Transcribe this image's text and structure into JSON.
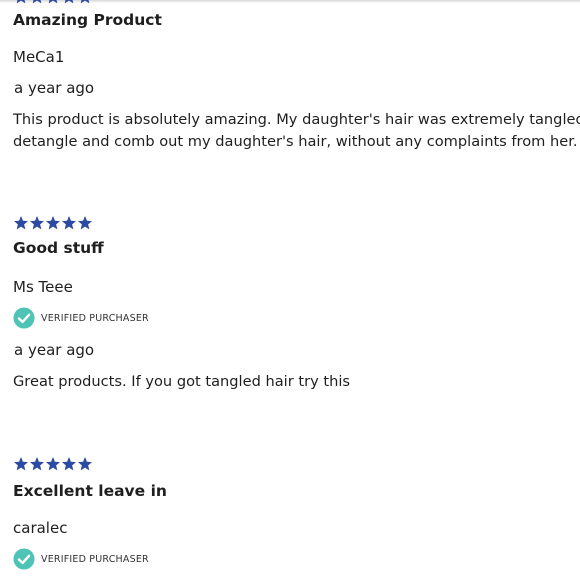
{
  "colors": {
    "star": "#2b4aa0",
    "verified": "#4fc3b5",
    "text": "#1f1f1f"
  },
  "reviews": [
    {
      "rating": 5,
      "title": "Amazing Product",
      "author": "MeCa1",
      "verified_label": "",
      "date": "a year ago",
      "body_line1": "This product is absolutely amazing. My daughter's hair was extremely tangled. The",
      "body_line2": "detangle and comb out my daughter's hair, without any complaints from her. The p"
    },
    {
      "rating": 5,
      "title": "Good stuff",
      "author": "Ms Teee",
      "verified_label": "VERIFIED PURCHASER",
      "date": "a year ago",
      "body_line1": "Great products. If you got tangled hair try this"
    },
    {
      "rating": 5,
      "title": "Excellent leave in",
      "author": "caralec",
      "verified_label": "VERIFIED PURCHASER"
    }
  ]
}
